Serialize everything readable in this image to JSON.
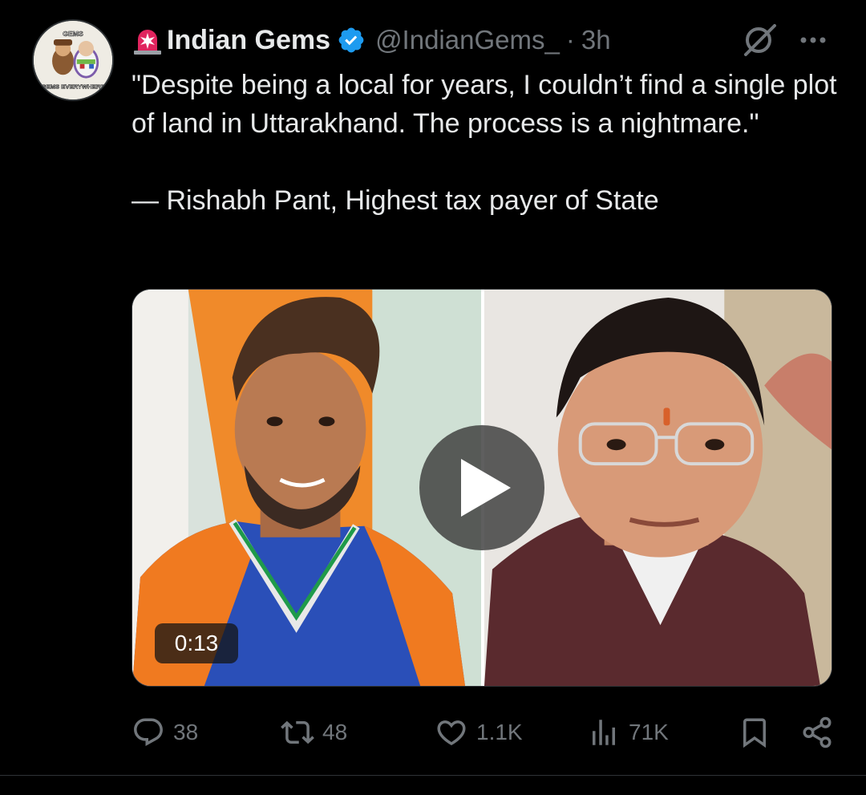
{
  "avatar": {
    "top_text": "GEMS",
    "bottom_text": "GEMS EVERYWHERE"
  },
  "author": {
    "display_name": "Indian Gems",
    "handle": "@IndianGems_",
    "separator": "·",
    "time": "3h",
    "verified": true
  },
  "tweet": {
    "text": "\"Despite being a local for years, I couldn’t find a single plot of land in Uttarakhand. The process is a nightmare.\"\n\n— Rishabh Pant, Highest tax payer of State"
  },
  "media": {
    "type": "video",
    "duration": "0:13"
  },
  "actions": {
    "reply_count": "38",
    "retweet_count": "48",
    "like_count": "1.1K",
    "views_count": "71K"
  },
  "icons": {
    "header": [
      "siren-icon",
      "verified-icon",
      "grok-icon",
      "more-icon"
    ],
    "actions": [
      "reply-icon",
      "retweet-icon",
      "like-icon",
      "views-icon",
      "bookmark-icon",
      "share-icon"
    ],
    "media": [
      "play-icon"
    ]
  },
  "colors": {
    "background": "#000000",
    "text_primary": "#e7e9ea",
    "text_secondary": "#71767b",
    "verified_blue": "#1d9bf0",
    "siren_red": "#e0245e"
  }
}
